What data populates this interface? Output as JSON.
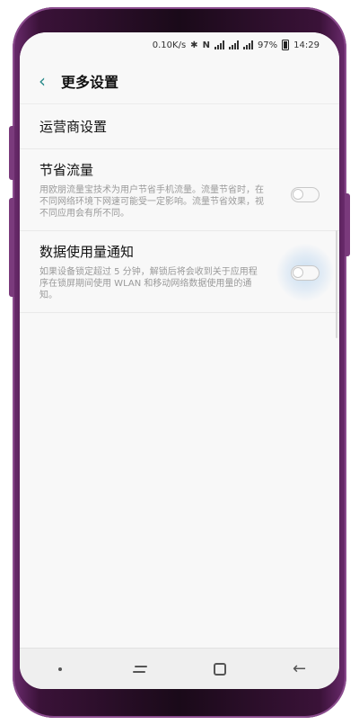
{
  "statusbar": {
    "net_speed": "0.10K/s",
    "bluetooth": "✱",
    "nfc": "N",
    "signal_2": "✕",
    "battery_pct": "97%",
    "time": "14:29"
  },
  "header": {
    "back_icon": "‹",
    "title": "更多设置"
  },
  "settings": {
    "carrier": {
      "title": "运营商设置"
    },
    "data_saver": {
      "title": "节省流量",
      "description": "用欧朋流量宝技术为用户节省手机流量。流量节省时，在不同网络环境下网速可能受一定影响。流量节省效果，视不同应用会有所不同。",
      "enabled": false
    },
    "data_usage_notify": {
      "title": "数据使用量通知",
      "description": "如果设备锁定超过 5 分钟，解锁后将会收到关于应用程序在锁屏期间使用 WLAN 和移动网络数据使用量的通知。",
      "enabled": false
    }
  },
  "navbar": {
    "back_icon": "←"
  },
  "colors": {
    "accent": "#2a8a8a",
    "frame": "#6b2b6e"
  }
}
